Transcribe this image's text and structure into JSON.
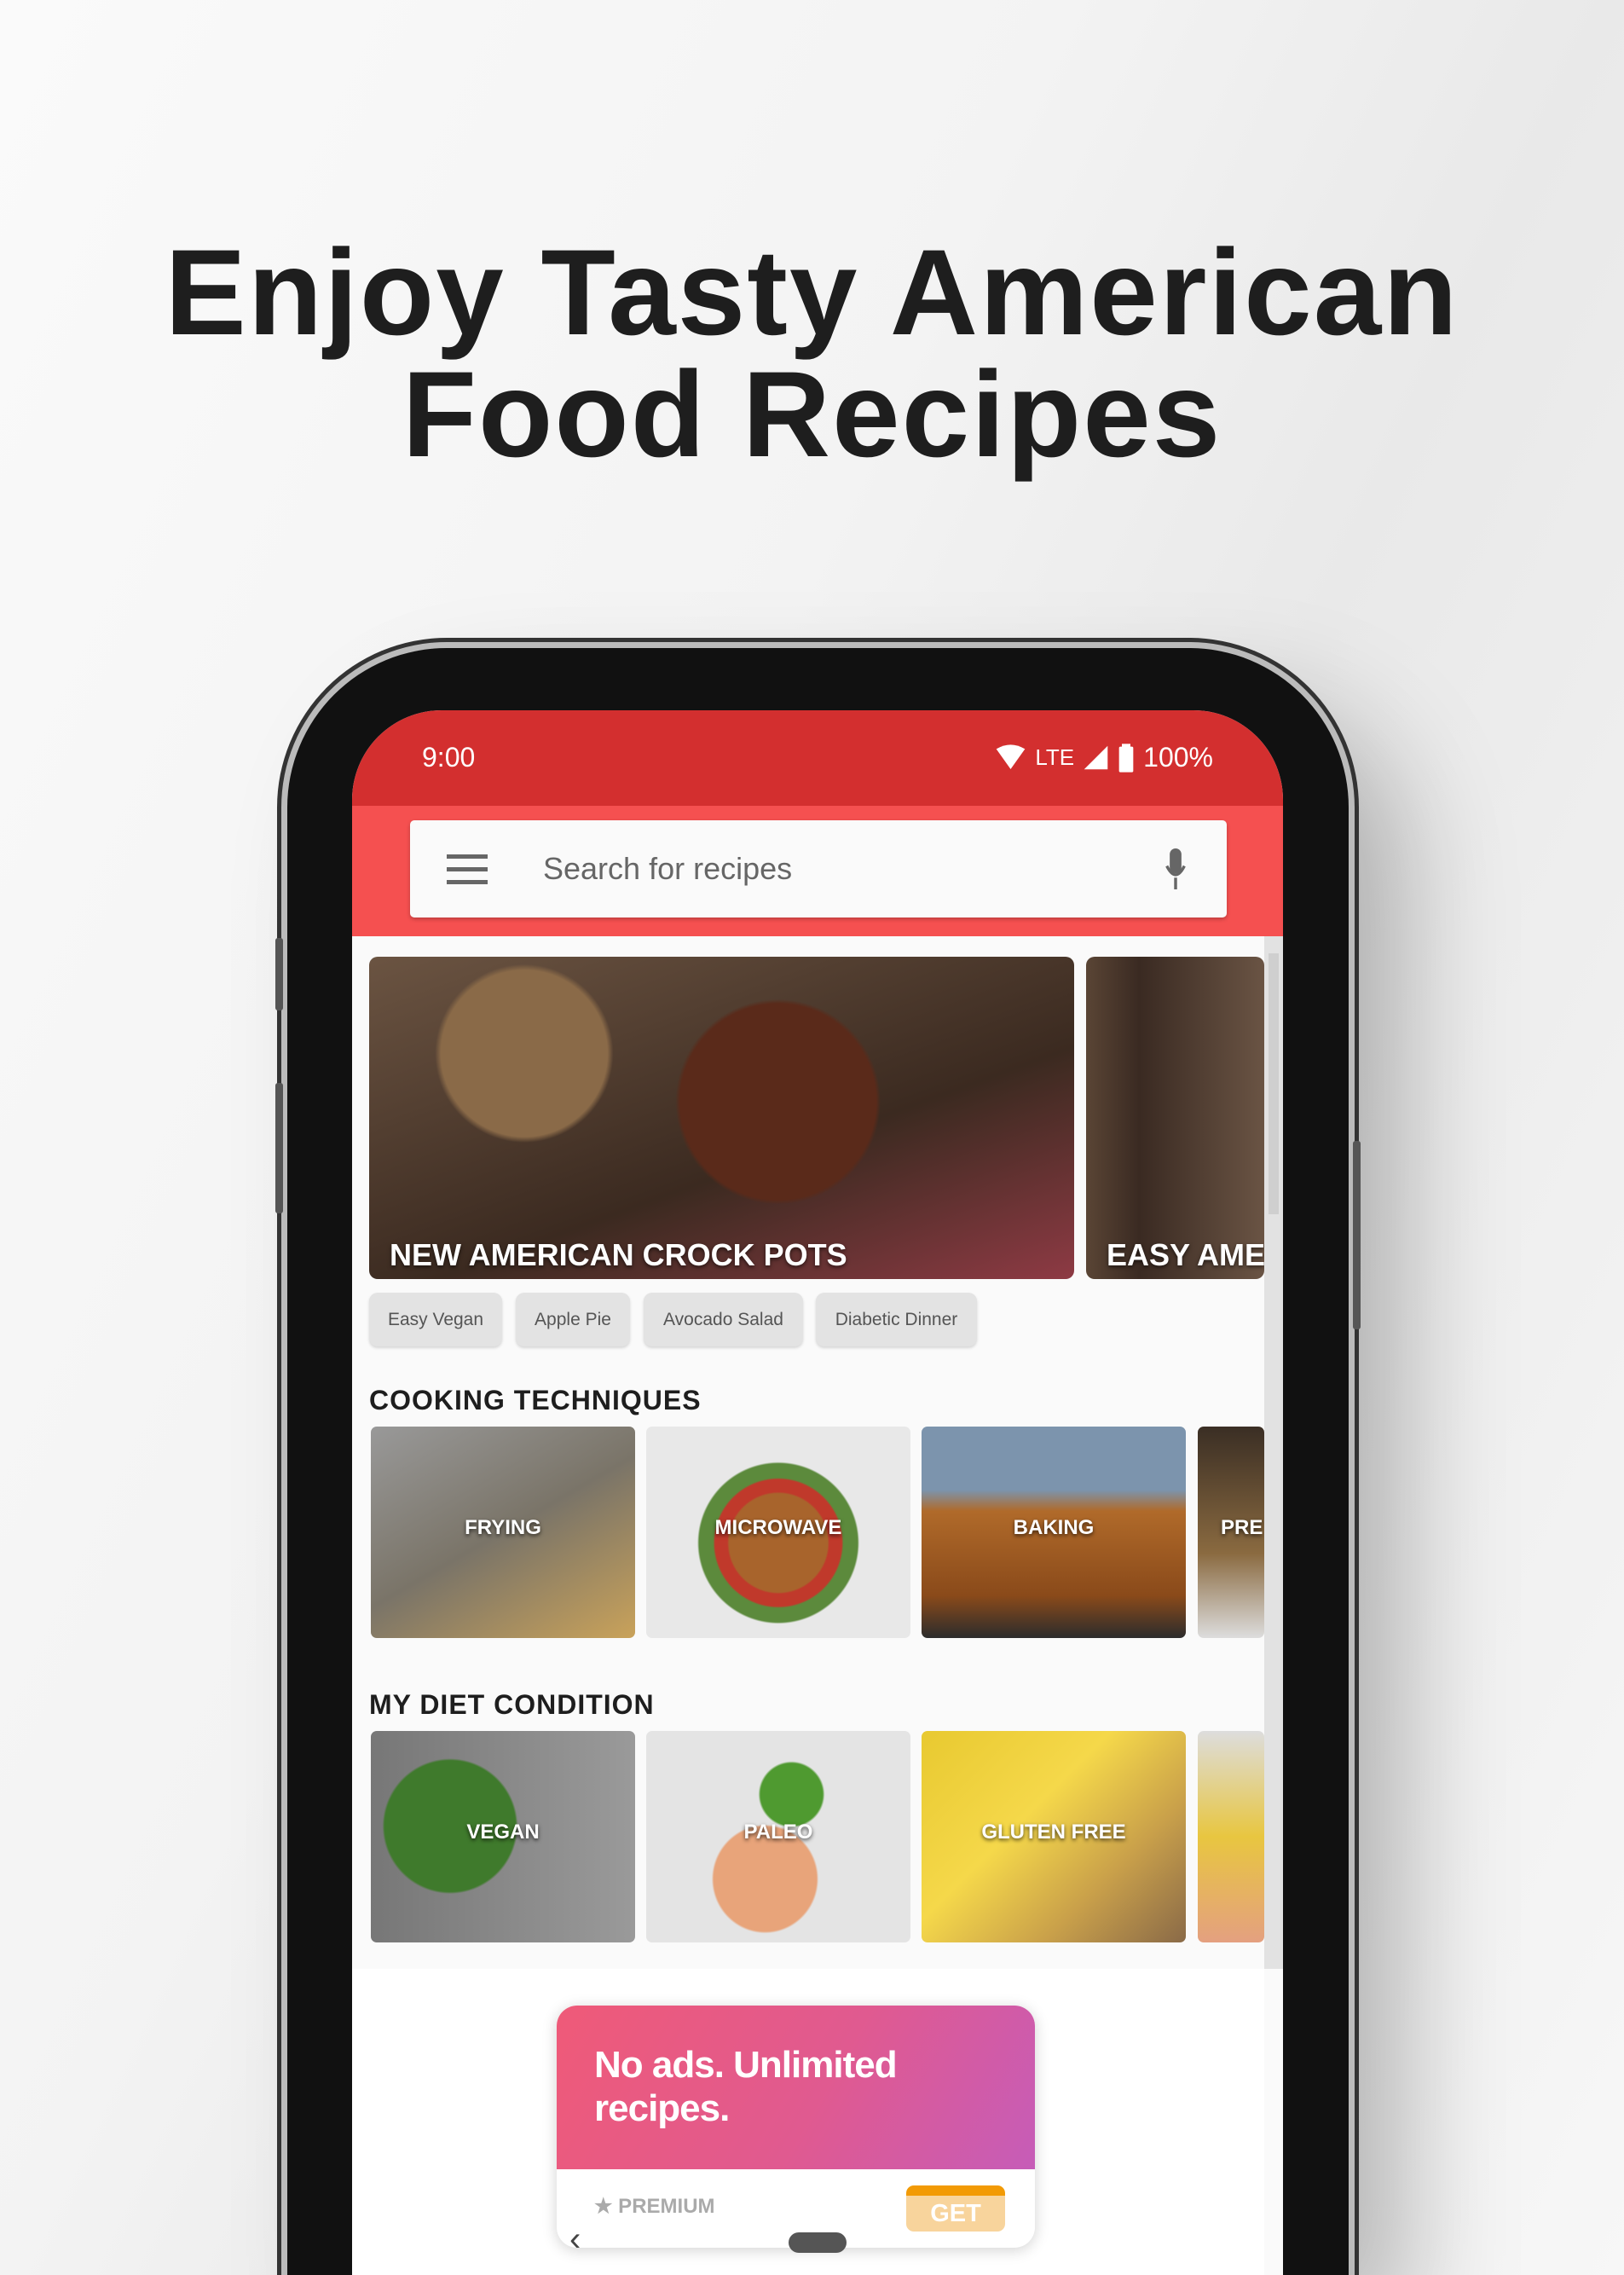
{
  "headline": {
    "line1": "Enjoy Tasty American",
    "line2": "Food Recipes"
  },
  "status_bar": {
    "time": "9:00",
    "network": "LTE",
    "battery": "100%"
  },
  "search": {
    "placeholder": "Search for recipes",
    "menu_icon": "hamburger-icon",
    "mic_icon": "microphone-icon"
  },
  "banners": [
    {
      "title": "NEW AMERICAN CROCK POTS"
    },
    {
      "title": "EASY AME"
    }
  ],
  "chips": [
    "Easy Vegan",
    "Apple Pie",
    "Avocado Salad",
    "Diabetic Dinner"
  ],
  "sections": [
    {
      "title": "COOKING TECHNIQUES",
      "tiles": [
        "FRYING",
        "MICROWAVE",
        "BAKING",
        "PRE"
      ]
    },
    {
      "title": "MY DIET CONDITION",
      "tiles": [
        "VEGAN",
        "PALEO",
        "GLUTEN FREE",
        ""
      ]
    }
  ],
  "promo": {
    "headline": "No ads. Unlimited recipes.",
    "label": "★ PREMIUM",
    "button": "GET"
  },
  "colors": {
    "status": "#d32f2f",
    "toolbar": "#f55050",
    "promo_start": "#ef5a78",
    "promo_end": "#c65cb8",
    "get": "#f29a05"
  }
}
